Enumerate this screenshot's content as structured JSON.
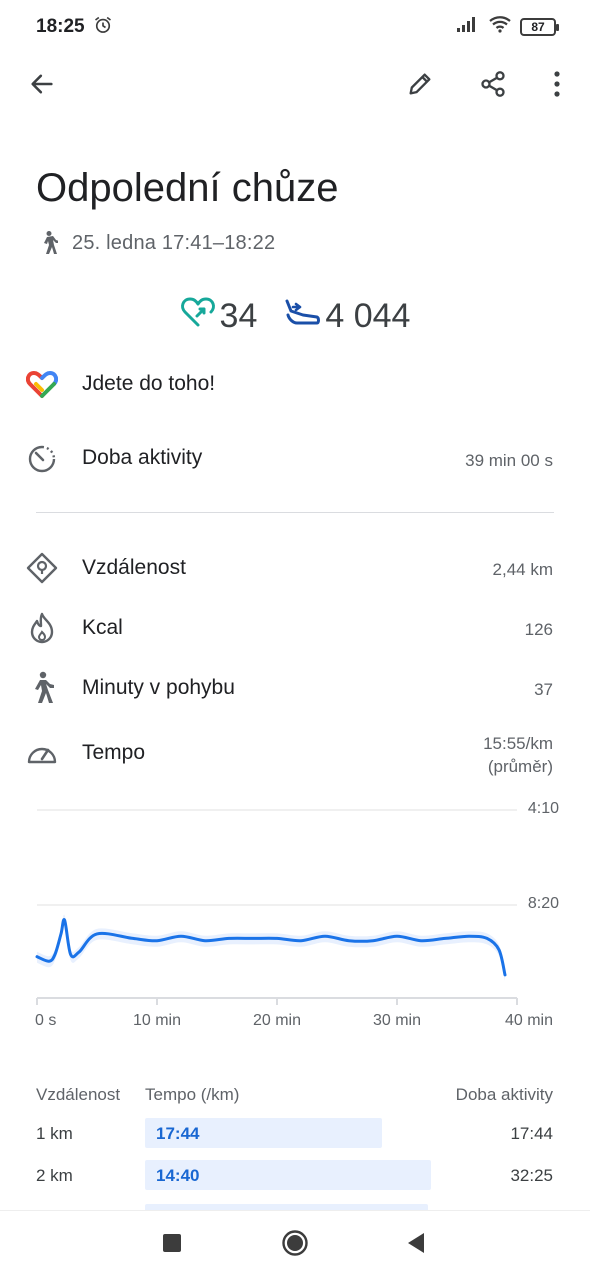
{
  "status": {
    "time": "18:25",
    "battery": "87"
  },
  "toolbar": {
    "back_icon": "arrow-left-icon",
    "edit_icon": "pencil-icon",
    "share_icon": "share-icon",
    "more_icon": "more-vert-icon"
  },
  "activity": {
    "title": "Odpolední chůze",
    "time_range": "25. ledna 17:41–18:22"
  },
  "metrics": {
    "heart_points": "34",
    "steps": "4 044",
    "heart_color": "#16a89a",
    "steps_color": "#1a4fa8"
  },
  "rows": {
    "motivation": "Jdete do toho!",
    "activity_label": "Doba aktivity",
    "activity_value": "39 min 00 s",
    "distance_label": "Vzdálenost",
    "distance_value": "2,44 km",
    "kcal_label": "Kcal",
    "kcal_value": "126",
    "move_minutes_label": "Minuty v pohybu",
    "move_minutes_value": "37",
    "pace_label": "Tempo",
    "pace_value_line1": "15:55/km",
    "pace_value_line2": "(průměr)"
  },
  "chart_data": {
    "type": "line",
    "x_unit": "min",
    "xlim": [
      0,
      40
    ],
    "x_ticks": [
      "0 s",
      "10 min",
      "20 min",
      "30 min",
      "40 min"
    ],
    "y_ticks": [
      "4:10",
      "8:20"
    ],
    "y_unit": "min/km (pace)",
    "series": [
      {
        "color": "#1a73e8",
        "x": [
          0,
          1,
          1.5,
          2,
          2.3,
          2.8,
          3.5,
          5,
          8,
          10,
          12,
          14,
          16,
          18,
          20,
          22,
          24,
          26,
          28,
          30,
          32,
          34,
          36,
          37.5,
          38.5,
          39
        ],
        "y": [
          10.6,
          10.8,
          10.5,
          9.6,
          9.0,
          10.5,
          10.4,
          9.6,
          9.8,
          9.9,
          9.7,
          9.9,
          9.8,
          9.8,
          9.8,
          9.9,
          9.7,
          9.9,
          9.9,
          9.7,
          9.9,
          9.8,
          9.7,
          9.8,
          10.3,
          11.4
        ]
      }
    ]
  },
  "table": {
    "headers": [
      "Vzdálenost",
      "Tempo (/km)",
      "Doba aktivity"
    ],
    "rows": [
      {
        "distance": "1 km",
        "pace": "17:44",
        "time": "17:44",
        "pace_fraction": 0.83
      },
      {
        "distance": "2 km",
        "pace": "14:40",
        "time": "32:25",
        "pace_fraction": 1.0
      },
      {
        "distance": "",
        "pace": "",
        "time": "",
        "pace_fraction": 0.99
      }
    ]
  },
  "navbar": {
    "recents_icon": "square-icon",
    "home_icon": "circle-icon",
    "back_icon": "triangle-back-icon"
  }
}
